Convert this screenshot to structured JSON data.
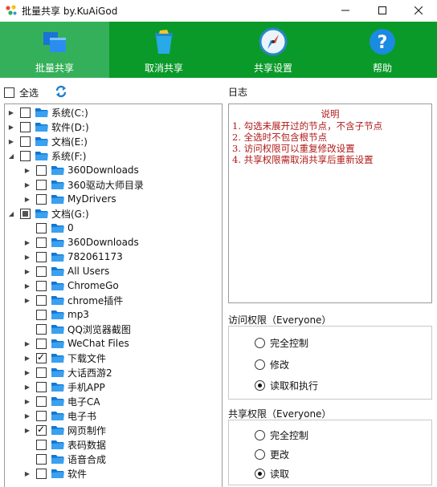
{
  "window": {
    "title": "批量共享 by.KuAiGod",
    "controls": [
      "minimize-icon",
      "maximize-icon",
      "close-icon"
    ]
  },
  "toolbar": {
    "accent": "#0a9a2a",
    "active_bg": "#35b05a",
    "items": [
      {
        "label": "批量共享",
        "icon": "share-windows-icon",
        "active": true
      },
      {
        "label": "取消共享",
        "icon": "trash-bin-icon",
        "active": false
      },
      {
        "label": "共享设置",
        "icon": "compass-icon",
        "active": false
      },
      {
        "label": "帮助",
        "icon": "help-question-icon",
        "active": false
      }
    ]
  },
  "select_all": {
    "label": "全选",
    "checked": false,
    "refresh_icon": "refresh-icon"
  },
  "tree": [
    {
      "label": "系统(C:)",
      "level": 0,
      "expanded": false,
      "state": "unchecked"
    },
    {
      "label": "软件(D:)",
      "level": 0,
      "expanded": false,
      "state": "unchecked"
    },
    {
      "label": "文档(E:)",
      "level": 0,
      "expanded": false,
      "state": "unchecked"
    },
    {
      "label": "系统(F:)",
      "level": 0,
      "expanded": true,
      "state": "unchecked"
    },
    {
      "label": "360Downloads",
      "level": 1,
      "expanded": false,
      "state": "unchecked"
    },
    {
      "label": "360驱动大师目录",
      "level": 1,
      "expanded": false,
      "state": "unchecked"
    },
    {
      "label": "MyDrivers",
      "level": 1,
      "expanded": false,
      "state": "unchecked"
    },
    {
      "label": "文档(G:)",
      "level": 0,
      "expanded": true,
      "state": "partial"
    },
    {
      "label": "0",
      "level": 1,
      "leaf": true,
      "state": "unchecked"
    },
    {
      "label": "360Downloads",
      "level": 1,
      "expanded": false,
      "state": "unchecked"
    },
    {
      "label": "782061173",
      "level": 1,
      "expanded": false,
      "state": "unchecked"
    },
    {
      "label": "All Users",
      "level": 1,
      "expanded": false,
      "state": "unchecked"
    },
    {
      "label": "ChromeGo",
      "level": 1,
      "expanded": false,
      "state": "unchecked"
    },
    {
      "label": "chrome插件",
      "level": 1,
      "expanded": false,
      "state": "unchecked"
    },
    {
      "label": "mp3",
      "level": 1,
      "leaf": true,
      "state": "unchecked"
    },
    {
      "label": "QQ浏览器截图",
      "level": 1,
      "leaf": true,
      "state": "unchecked"
    },
    {
      "label": "WeChat Files",
      "level": 1,
      "expanded": false,
      "state": "unchecked"
    },
    {
      "label": "下载文件",
      "level": 1,
      "expanded": false,
      "state": "checked"
    },
    {
      "label": "大话西游2",
      "level": 1,
      "expanded": false,
      "state": "unchecked"
    },
    {
      "label": "手机APP",
      "level": 1,
      "expanded": false,
      "state": "unchecked"
    },
    {
      "label": "电子CA",
      "level": 1,
      "expanded": false,
      "state": "unchecked"
    },
    {
      "label": "电子书",
      "level": 1,
      "expanded": false,
      "state": "unchecked"
    },
    {
      "label": "网页制作",
      "level": 1,
      "expanded": false,
      "state": "checked"
    },
    {
      "label": "表码数据",
      "level": 1,
      "leaf": true,
      "state": "unchecked"
    },
    {
      "label": "语音合成",
      "level": 1,
      "leaf": true,
      "state": "unchecked"
    },
    {
      "label": "软件",
      "level": 1,
      "expanded": false,
      "state": "unchecked"
    }
  ],
  "log": {
    "title": "日志",
    "heading": "说明",
    "lines": [
      "1. 勾选未展开过的节点，不含子节点",
      "2. 全选时不包含根节点",
      "3. 访问权限可以重复修改设置",
      "4. 共享权限需取消共享后重新设置"
    ],
    "text_color": "#b01818"
  },
  "access": {
    "title": "访问权限（Everyone）",
    "options": [
      "完全控制",
      "修改",
      "读取和执行"
    ],
    "selected": 2
  },
  "share": {
    "title": "共享权限（Everyone）",
    "options": [
      "完全控制",
      "更改",
      "读取"
    ],
    "selected": 2
  }
}
